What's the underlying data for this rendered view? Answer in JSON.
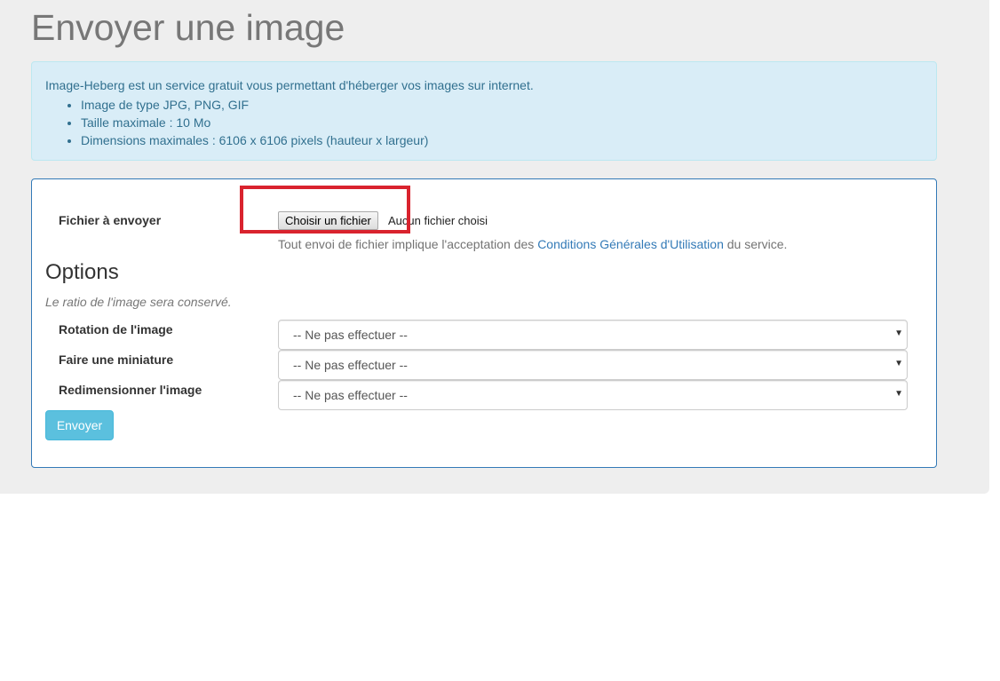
{
  "header": {
    "title": "Envoyer une image"
  },
  "info": {
    "intro": "Image-Heberg est un service gratuit vous permettant d'héberger vos images sur internet.",
    "items": [
      "Image de type JPG, PNG, GIF",
      "Taille maximale : 10 Mo",
      "Dimensions maximales : 6106 x 6106 pixels (hauteur x largeur)"
    ]
  },
  "form": {
    "file_label": "Fichier à envoyer",
    "file_button": "Choisir un fichier",
    "file_status": "Aucun fichier choisi",
    "terms_prefix": "Tout envoi de fichier implique l'acceptation des ",
    "terms_link": "Conditions Générales d'Utilisation",
    "terms_suffix": " du service.",
    "options_title": "Options",
    "ratio_note": "Le ratio de l'image sera conservé.",
    "rotation_label": "Rotation de l'image",
    "rotation_value": "-- Ne pas effectuer --",
    "thumbnail_label": "Faire une miniature",
    "thumbnail_value": "-- Ne pas effectuer --",
    "resize_label": "Redimensionner l'image",
    "resize_value": "-- Ne pas effectuer --",
    "submit_label": "Envoyer"
  },
  "colors": {
    "highlight": "#d9232e",
    "info_background": "#d9edf7",
    "info_text": "#31708f",
    "panel_border": "#337ab7",
    "button": "#5bc0de"
  },
  "icons": {
    "select_arrow": "caret-down-icon"
  }
}
